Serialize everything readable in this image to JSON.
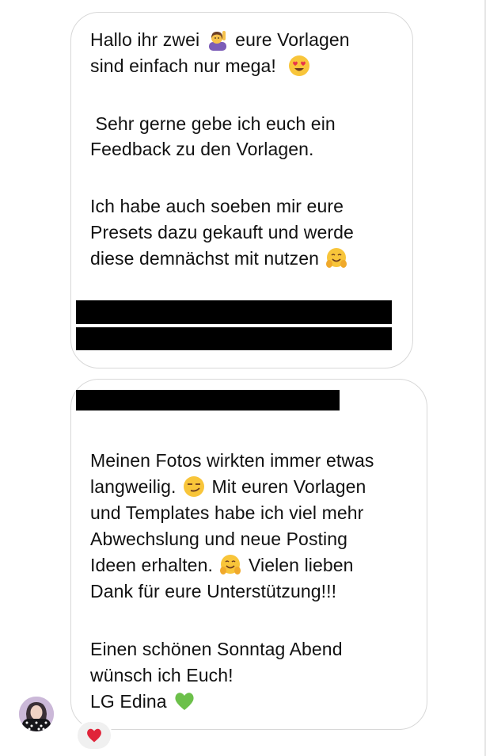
{
  "message_1": {
    "lines": [
      "Hallo ihr zwei",
      "eure Vorlagen",
      "sind einfach nur mega!",
      "Sehr gerne gebe ich euch ein",
      "Feedback zu den Vorlagen.",
      "Ich habe auch soeben mir eure",
      "Presets dazu gekauft und werde",
      "diese demnächst mit nutzen"
    ],
    "icons": [
      "raising-hand-emoji",
      "heart-eyes-emoji",
      "hugging-face-emoji"
    ]
  },
  "message_2": {
    "lines": [
      "Meinen Fotos wirkten immer etwas",
      "langweilig.",
      "Mit euren Vorlagen",
      "und Templates habe ich viel mehr",
      "Abwechslung und neue Posting",
      "Ideen erhalten.",
      "Vielen lieben",
      "Dank für eure Unterstützung!!!",
      "Einen schönen Sonntag Abend",
      "wünsch ich Euch!",
      "LG Edina"
    ],
    "icons": [
      "smirk-emoji",
      "hugging-face-emoji",
      "green-heart-emoji"
    ]
  },
  "reaction": {
    "icon": "red-heart-emoji"
  },
  "colors": {
    "bubble_border": "#d8d8d8",
    "text": "#111111",
    "reaction_bg": "#f0f0f0",
    "redaction": "#000000"
  }
}
